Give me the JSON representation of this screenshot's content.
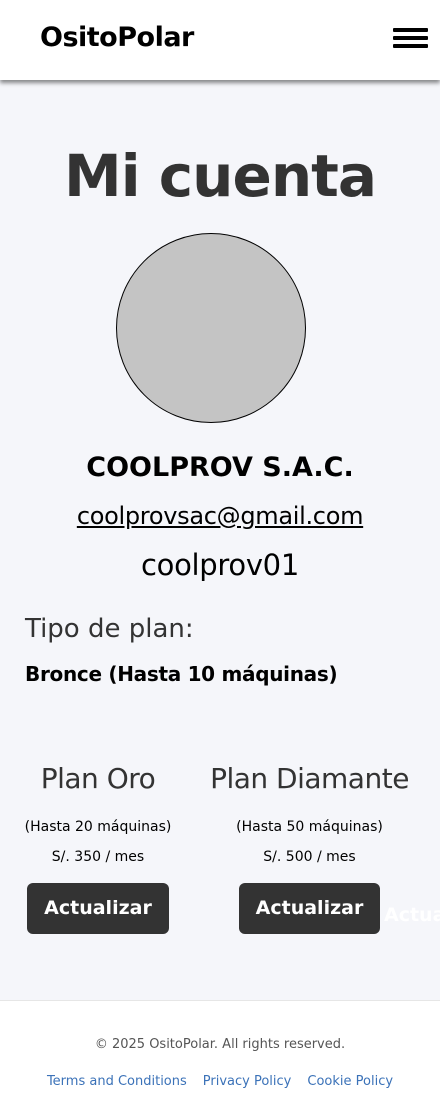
{
  "header": {
    "brand": "OsitoPolar",
    "menu_icon": "hamburger-menu-icon"
  },
  "account": {
    "title": "Mi cuenta",
    "company_name": "COOLPROV S.A.C.",
    "email": "coolprovsac@gmail.com",
    "username": "coolprov01",
    "plan_type_label": "Tipo de plan:",
    "current_plan": "Bronce (Hasta 10 máquinas)"
  },
  "plans": [
    {
      "name": "Plan Oro",
      "limit": "(Hasta 20 máquinas)",
      "price": "S/. 350 / mes",
      "button_label": "Actualizar"
    },
    {
      "name": "Plan Diamante",
      "limit": "(Hasta 50 máquinas)",
      "price": "S/. 500 / mes",
      "button_label": "Actualizar"
    }
  ],
  "overflow_button_label": "Actualizar",
  "footer": {
    "copyright": "© 2025 OsitoPolar. All rights reserved.",
    "links": [
      "Terms and Conditions",
      "Privacy Policy",
      "Cookie Policy"
    ]
  },
  "colors": {
    "page_background": "#f5f6fa",
    "button_background": "#333333",
    "avatar_fill": "#c4c4c4",
    "link_color": "#3b72b8"
  }
}
